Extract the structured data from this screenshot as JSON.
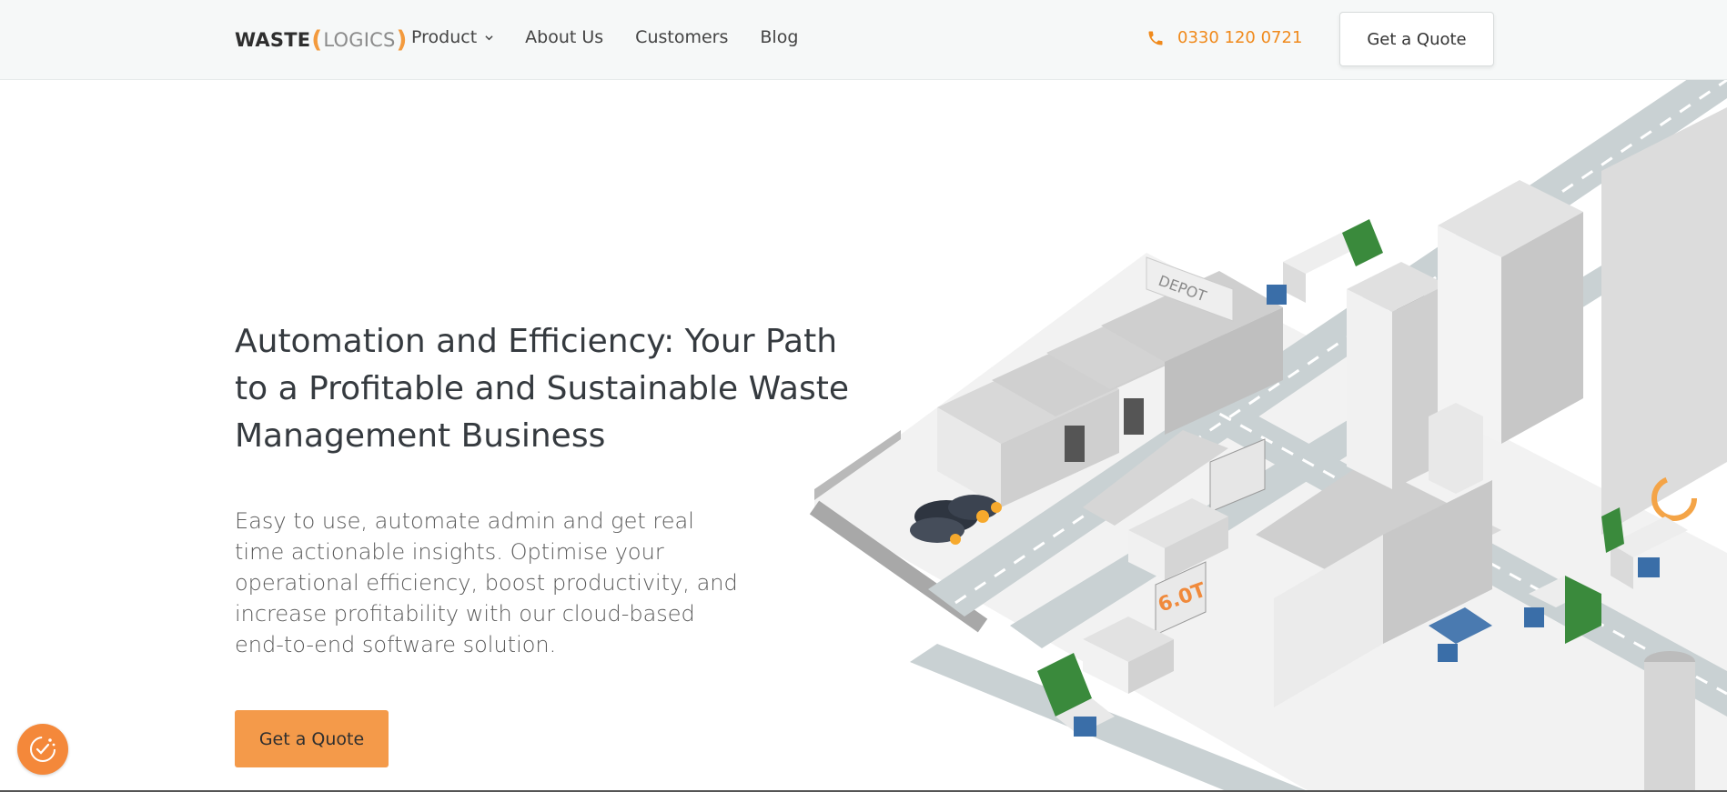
{
  "header": {
    "logo": {
      "part1": "WASTE",
      "bracket_open": "(",
      "part2": "LOGICS",
      "bracket_close": ")"
    },
    "nav": [
      {
        "label": "Product",
        "has_dropdown": true
      },
      {
        "label": "About Us"
      },
      {
        "label": "Customers"
      },
      {
        "label": "Blog"
      }
    ],
    "phone": "0330 120 0721",
    "quote_button": "Get a Quote"
  },
  "hero": {
    "title": "Automation and Efficiency: Your Path to a Profitable and Sustainable Waste Management Business",
    "subtitle": "Easy to use, automate admin and get real time actionable insights. Optimise your operational efficiency, boost productivity, and increase profitability with our cloud-based end-to-end software solution.",
    "cta": "Get a Quote"
  },
  "illustration": {
    "depot_sign": "DEPOT",
    "billboard_text": "6.0T",
    "icons": [
      "truck-icon",
      "building-icon",
      "recycle-icon",
      "loading-ring-icon"
    ]
  },
  "cookie_widget": {
    "icon": "cookie-consent-icon"
  },
  "colors": {
    "accent": "#f49a4a",
    "phone": "#f08a1c",
    "header_bg": "#f6f8f8",
    "text": "#353a3f",
    "truck_green": "#3a8a3c",
    "truck_blue": "#3a6ea8"
  }
}
